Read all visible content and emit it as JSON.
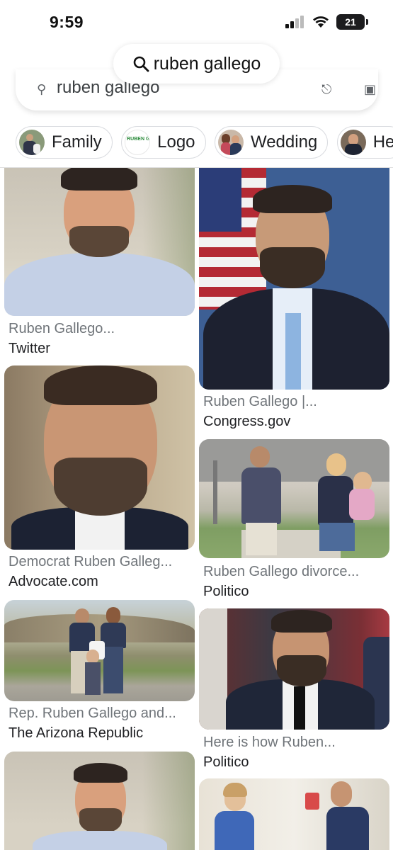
{
  "status": {
    "time": "9:59",
    "battery": "21"
  },
  "address_bar": {
    "query": "ruben gallego"
  },
  "search": {
    "query": "ruben gallego"
  },
  "chips": [
    {
      "label": "Family",
      "thumb_icon": "family-photo-thumb"
    },
    {
      "label": "Logo",
      "thumb_icon": "logo-thumb"
    },
    {
      "label": "Wedding",
      "thumb_icon": "wedding-photo-thumb"
    },
    {
      "label": "He",
      "thumb_icon": "portrait-thumb"
    }
  ],
  "logo_thumb_text": "RUBEN GALLEGO",
  "results": [
    {
      "title": "Ruben Gallego...",
      "source": "Twitter"
    },
    {
      "title": "Ruben Gallego |...",
      "source": "Congress.gov"
    },
    {
      "title": "Democrat Ruben Galleg...",
      "source": "Advocate.com"
    },
    {
      "title": "Ruben Gallego divorce...",
      "source": "Politico"
    },
    {
      "title": "Rep. Ruben Gallego and...",
      "source": "The Arizona Republic"
    },
    {
      "title": "Here is how Ruben...",
      "source": "Politico"
    }
  ],
  "colors": {
    "accent": "#1a73e8",
    "chip_border": "#dadce0",
    "title_gray": "#70757a"
  }
}
